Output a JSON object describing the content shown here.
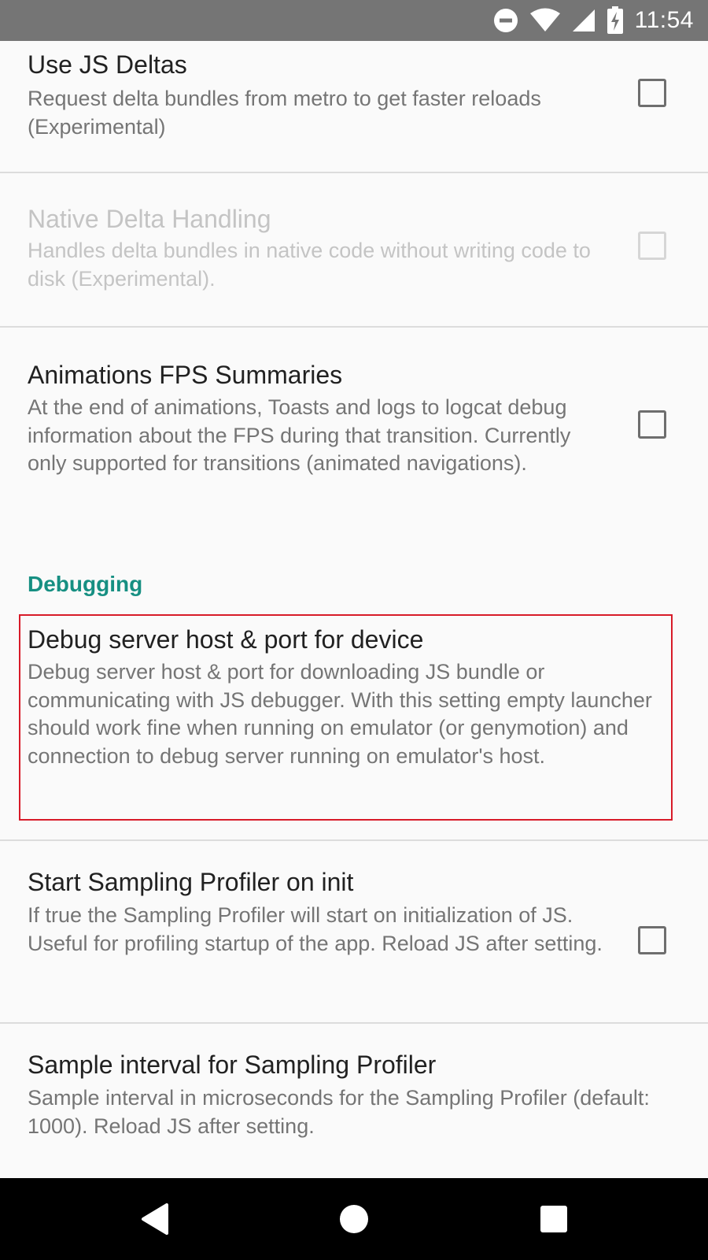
{
  "status_bar": {
    "time": "11:54",
    "icons": [
      "do-not-disturb-icon",
      "wifi-icon",
      "cell-signal-icon",
      "battery-charging-icon"
    ]
  },
  "preferences": [
    {
      "title": "Use JS Deltas",
      "summary": "Request delta bundles from metro to get faster reloads (Experimental)",
      "has_checkbox": true,
      "checked": false,
      "enabled": true
    },
    {
      "title": "Native Delta Handling",
      "summary": "Handles delta bundles in native code without writing code to disk (Experimental).",
      "has_checkbox": true,
      "checked": false,
      "enabled": false
    },
    {
      "title": "Animations FPS Summaries",
      "summary": "At the end of animations, Toasts and logs to logcat debug information about the FPS during that transition. Currently only supported for transitions (animated navigations).",
      "has_checkbox": true,
      "checked": false,
      "enabled": true
    },
    {
      "title": "Debug server host & port for device",
      "summary": "Debug server host & port for downloading JS bundle or communicating with JS debugger. With this setting empty launcher should work fine when running on emulator (or genymotion) and connection to debug server running on emulator's host.",
      "has_checkbox": false,
      "enabled": true,
      "highlighted": true
    },
    {
      "title": "Start Sampling Profiler on init",
      "summary": "If true the Sampling Profiler will start on initialization of JS. Useful for profiling startup of the app. Reload JS after setting.",
      "has_checkbox": true,
      "checked": false,
      "enabled": true
    },
    {
      "title": "Sample interval for Sampling Profiler",
      "summary": "Sample interval in microseconds for the Sampling Profiler (default: 1000). Reload JS after setting.",
      "has_checkbox": false,
      "enabled": true
    }
  ],
  "category": {
    "label": "Debugging"
  },
  "nav_bar": {
    "buttons": [
      "back-icon",
      "home-icon",
      "recents-icon"
    ]
  },
  "colors": {
    "status_bar": "#757575",
    "accent": "#168f82",
    "highlight": "#d81b29",
    "background": "#fafafa"
  }
}
